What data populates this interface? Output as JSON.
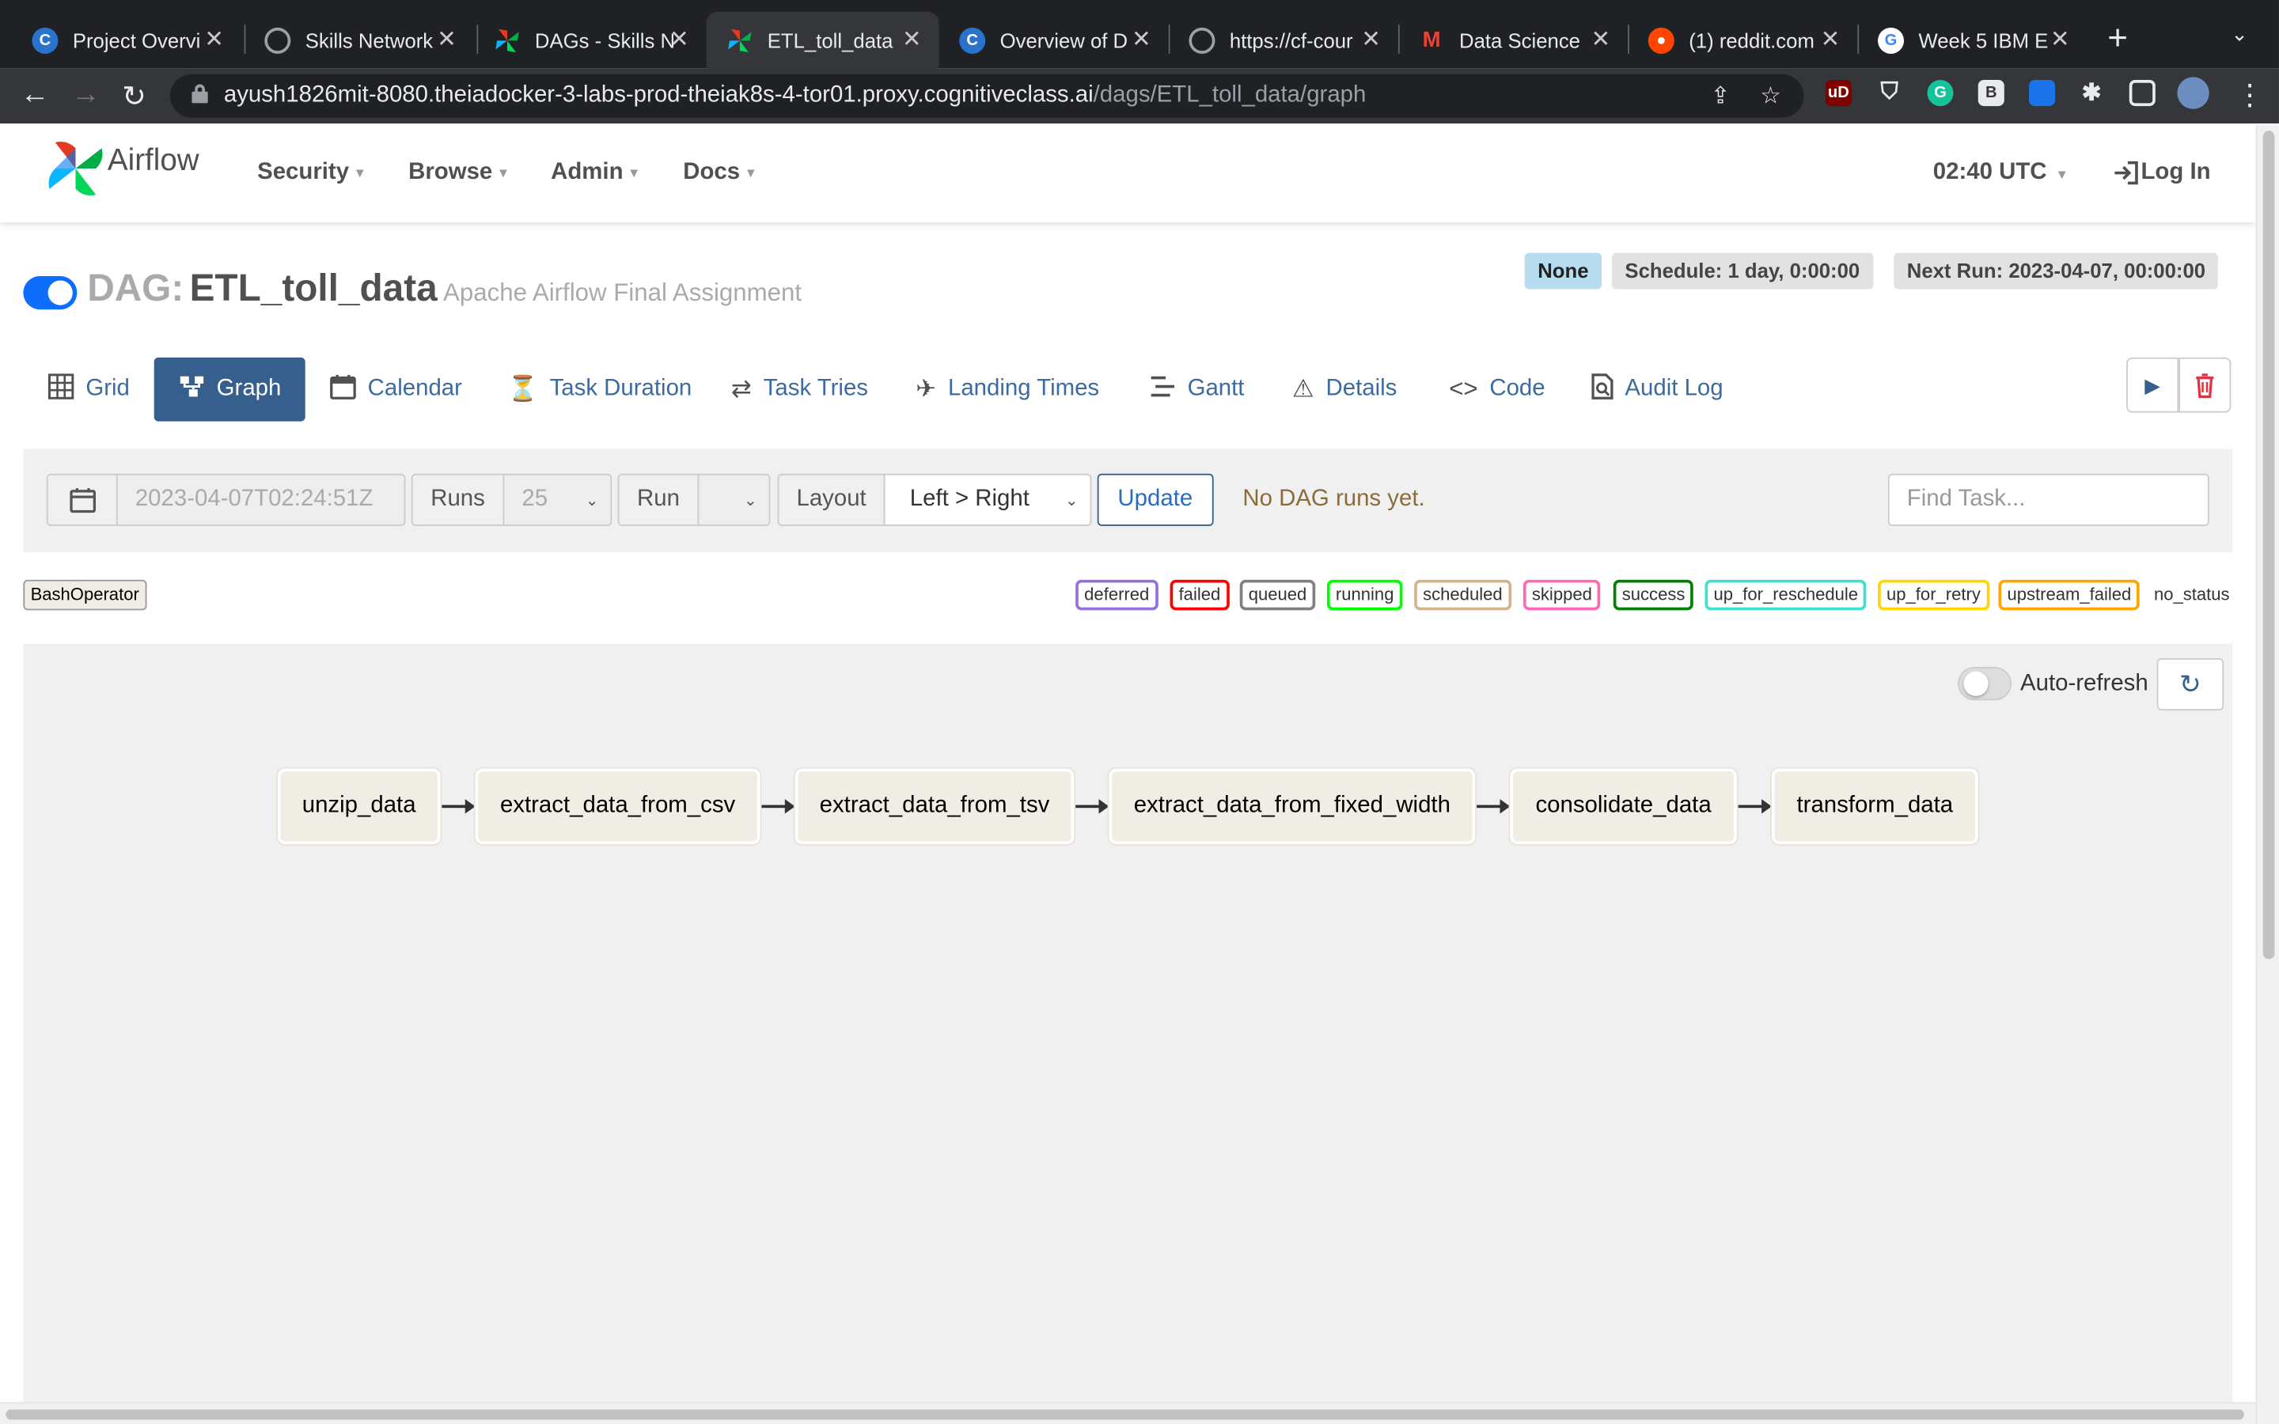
{
  "browser": {
    "tabs": [
      {
        "title": "Project Overvi",
        "favicon": "coursera-c-icon"
      },
      {
        "title": "Skills Network",
        "favicon": "globe-icon"
      },
      {
        "title": "DAGs - Skills N",
        "favicon": "airflow-pinwheel-icon"
      },
      {
        "title": "ETL_toll_data",
        "favicon": "airflow-pinwheel-icon",
        "active": true
      },
      {
        "title": "Overview of D",
        "favicon": "coursera-c-icon"
      },
      {
        "title": "https://cf-cour",
        "favicon": "globe-icon"
      },
      {
        "title": "Data Science",
        "favicon": "gmail-icon"
      },
      {
        "title": "(1) reddit.com",
        "favicon": "reddit-icon"
      },
      {
        "title": "Week 5 IBM E",
        "favicon": "google-g-icon"
      }
    ],
    "url_host": "ayush1826mit-8080.theiadocker-3-labs-prod-theiak8s-4-tor01.proxy.cognitiveclass.ai",
    "url_path": "/dags/ETL_toll_data/graph",
    "extension_badges": {
      "ublock": "uD",
      "grammarly": "G",
      "b": "B"
    }
  },
  "navbar": {
    "brand": "Airflow",
    "menus": [
      "Security",
      "Browse",
      "Admin",
      "Docs"
    ],
    "clock": "02:40 UTC",
    "login": "Log In"
  },
  "dag": {
    "label": "DAG:",
    "id": "ETL_toll_data",
    "description": "Apache Airflow Final Assignment",
    "is_active": true,
    "badge_none": "None",
    "schedule": "Schedule: 1 day, 0:00:00",
    "next_run": "Next Run: 2023-04-07, 00:00:00"
  },
  "view_tabs": [
    {
      "label": "Grid",
      "icon": "grid-icon"
    },
    {
      "label": "Graph",
      "icon": "graph-icon",
      "active": true
    },
    {
      "label": "Calendar",
      "icon": "calendar-icon"
    },
    {
      "label": "Task Duration",
      "icon": "hourglass-icon"
    },
    {
      "label": "Task Tries",
      "icon": "repeat-icon"
    },
    {
      "label": "Landing Times",
      "icon": "plane-landing-icon"
    },
    {
      "label": "Gantt",
      "icon": "gantt-icon"
    },
    {
      "label": "Details",
      "icon": "warning-triangle-icon"
    },
    {
      "label": "Code",
      "icon": "code-icon"
    },
    {
      "label": "Audit Log",
      "icon": "document-search-icon"
    }
  ],
  "filters": {
    "date_value": "2023-04-07T02:24:51Z",
    "runs_label": "Runs",
    "runs_value": "25",
    "run_label": "Run",
    "run_value": "",
    "layout_label": "Layout",
    "layout_value": "Left > Right",
    "update_label": "Update",
    "message": "No DAG runs yet.",
    "find_placeholder": "Find Task..."
  },
  "operator_badge": "BashOperator",
  "legend": [
    {
      "label": "deferred",
      "color": "#9370db"
    },
    {
      "label": "failed",
      "color": "#ff0000"
    },
    {
      "label": "queued",
      "color": "#808080"
    },
    {
      "label": "running",
      "color": "#00ff00"
    },
    {
      "label": "scheduled",
      "color": "#d2b48c"
    },
    {
      "label": "skipped",
      "color": "#ff69b4"
    },
    {
      "label": "success",
      "color": "#008000"
    },
    {
      "label": "up_for_reschedule",
      "color": "#40e0d0"
    },
    {
      "label": "up_for_retry",
      "color": "#ffd700"
    },
    {
      "label": "upstream_failed",
      "color": "#ffa500"
    }
  ],
  "legend_no_status": "no_status",
  "graph": {
    "auto_refresh_label": "Auto-refresh",
    "auto_refresh_on": false,
    "tasks": [
      "unzip_data",
      "extract_data_from_csv",
      "extract_data_from_tsv",
      "extract_data_from_fixed_width",
      "consolidate_data",
      "transform_data"
    ]
  }
}
